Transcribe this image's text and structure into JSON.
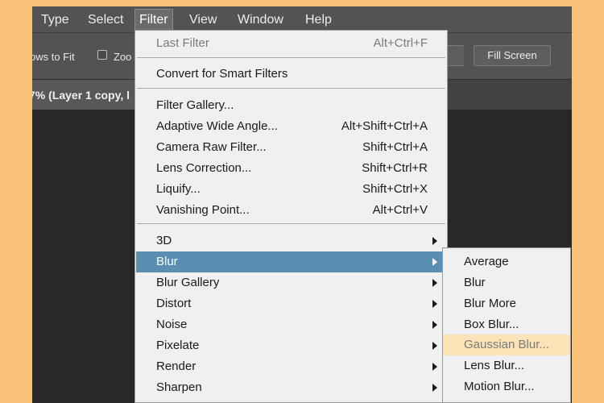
{
  "menubar": {
    "items": [
      "Type",
      "Select",
      "Filter",
      "View",
      "Window",
      "Help"
    ],
    "active": "Filter"
  },
  "options": {
    "resize_label": "ows to Fit",
    "zoom_label": "Zoo",
    "fill_screen_label": "Fill Screen"
  },
  "document": {
    "tab_title": "7% (Layer 1 copy, l"
  },
  "filter_menu": {
    "last_filter": {
      "label": "Last Filter",
      "shortcut": "Alt+Ctrl+F"
    },
    "convert": {
      "label": "Convert for Smart Filters"
    },
    "filter_gallery": {
      "label": "Filter Gallery..."
    },
    "adaptive": {
      "label": "Adaptive Wide Angle...",
      "shortcut": "Alt+Shift+Ctrl+A"
    },
    "camera_raw": {
      "label": "Camera Raw Filter...",
      "shortcut": "Shift+Ctrl+A"
    },
    "lens_correction": {
      "label": "Lens Correction...",
      "shortcut": "Shift+Ctrl+R"
    },
    "liquify": {
      "label": "Liquify...",
      "shortcut": "Shift+Ctrl+X"
    },
    "vanishing": {
      "label": "Vanishing Point...",
      "shortcut": "Alt+Ctrl+V"
    },
    "submenus": [
      "3D",
      "Blur",
      "Blur Gallery",
      "Distort",
      "Noise",
      "Pixelate",
      "Render",
      "Sharpen"
    ],
    "highlighted": "Blur"
  },
  "blur_submenu": {
    "items": [
      "Average",
      "Blur",
      "Blur More",
      "Box Blur...",
      "Gaussian Blur...",
      "Lens Blur...",
      "Motion Blur..."
    ],
    "hovered": "Gaussian Blur..."
  },
  "colors": {
    "background": "#f9c278",
    "menu_highlight": "#5b8fb2",
    "submenu_hover": "#fbe3b7"
  }
}
